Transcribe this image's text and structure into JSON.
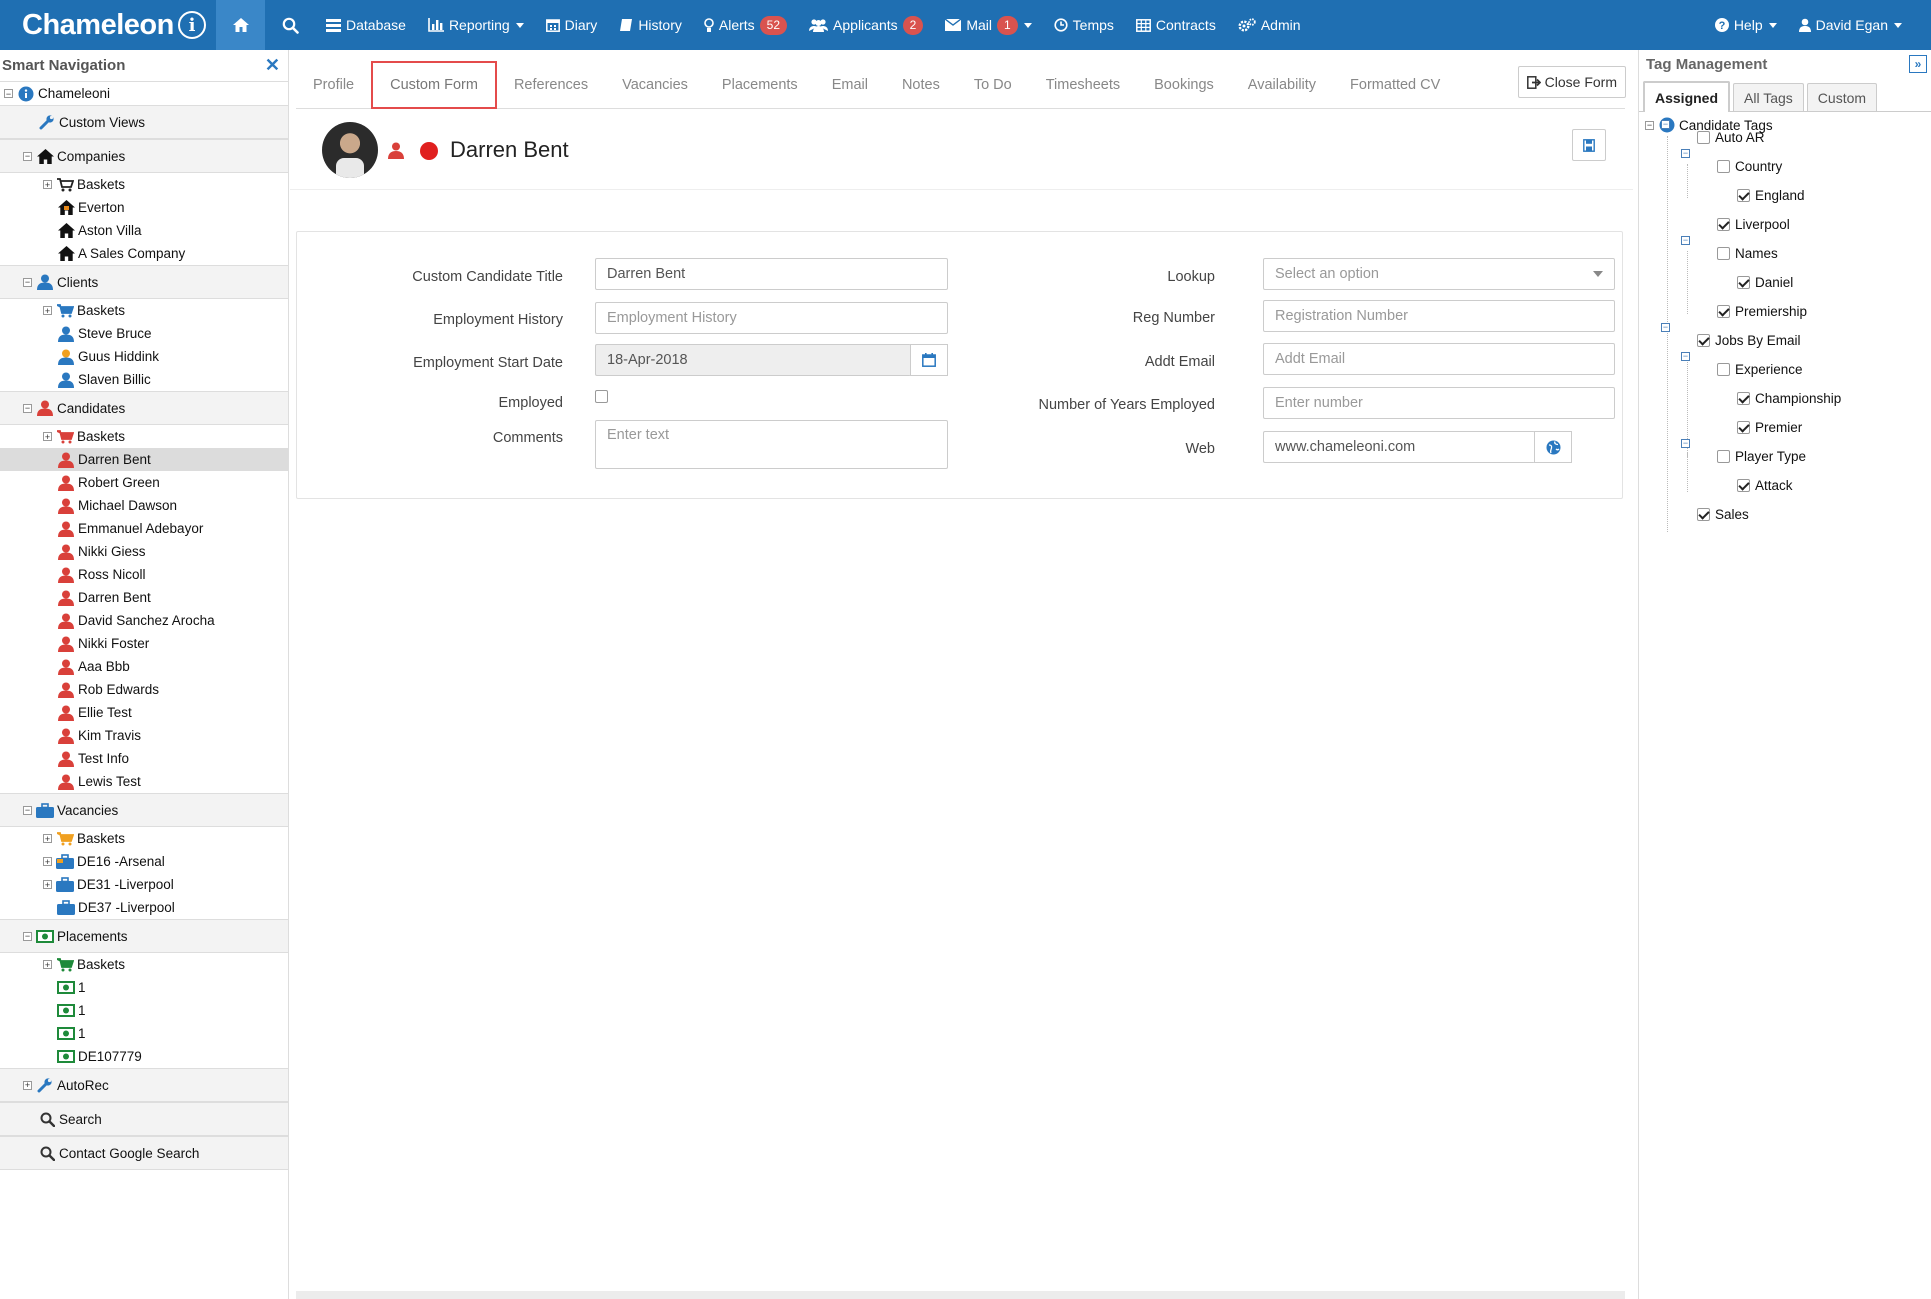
{
  "app": {
    "brand": "Chameleon",
    "brand_icon": "i"
  },
  "topnav": {
    "items": [
      {
        "label": "Database",
        "icon": "database-icon"
      },
      {
        "label": "Reporting",
        "icon": "bar-chart-icon",
        "dropdown": true
      },
      {
        "label": "Diary",
        "icon": "calendar-icon"
      },
      {
        "label": "History",
        "icon": "book-icon"
      },
      {
        "label": "Alerts",
        "icon": "bulb-icon",
        "badge": "52"
      },
      {
        "label": "Applicants",
        "icon": "users-icon",
        "badge": "2"
      },
      {
        "label": "Mail",
        "icon": "envelope-icon",
        "badge": "1",
        "dropdown": true
      },
      {
        "label": "Temps",
        "icon": "clock-icon"
      },
      {
        "label": "Contracts",
        "icon": "table-icon"
      },
      {
        "label": "Admin",
        "icon": "cogs-icon"
      }
    ],
    "help_label": "Help",
    "user_label": "David Egan"
  },
  "sidebar": {
    "title": "Smart Navigation",
    "root": "Chameleoni",
    "custom_views": "Custom Views",
    "companies": {
      "label": "Companies",
      "items": [
        "Baskets",
        "Everton",
        "Aston Villa",
        "A Sales Company"
      ]
    },
    "clients": {
      "label": "Clients",
      "items": [
        "Baskets",
        "Steve Bruce",
        "Guus Hiddink",
        "Slaven Billic"
      ]
    },
    "candidates": {
      "label": "Candidates",
      "items": [
        "Baskets",
        "Darren Bent",
        "Robert Green",
        "Michael Dawson",
        "Emmanuel Adebayor",
        "Nikki Giess",
        "Ross Nicoll",
        "Darren Bent",
        "David Sanchez Arocha",
        "Nikki Foster",
        "Aaa Bbb",
        "Rob Edwards",
        "Ellie Test",
        "Kim Travis",
        "Test Info",
        "Lewis Test"
      ],
      "selected_index": 1
    },
    "vacancies": {
      "label": "Vacancies",
      "items": [
        "Baskets",
        "DE16 -Arsenal",
        "DE31 -Liverpool",
        "DE37 -Liverpool"
      ]
    },
    "placements": {
      "label": "Placements",
      "items": [
        "Baskets",
        "1",
        "1",
        "1",
        "DE107779"
      ]
    },
    "autorec": "AutoRec",
    "search": "Search",
    "google_search": "Contact Google Search"
  },
  "tabs": [
    "Profile",
    "Custom Form",
    "References",
    "Vacancies",
    "Placements",
    "Email",
    "Notes",
    "To Do",
    "Timesheets",
    "Bookings",
    "Availability",
    "Formatted CV"
  ],
  "active_tab": "Custom Form",
  "close_form_label": "Close Form",
  "candidate": {
    "name": "Darren Bent",
    "status_color": "#e0201f"
  },
  "form": {
    "custom_title": {
      "label": "Custom Candidate Title",
      "value": "Darren Bent"
    },
    "employment_history": {
      "label": "Employment History",
      "placeholder": "Employment History"
    },
    "start_date": {
      "label": "Employment Start Date",
      "value": "18-Apr-2018"
    },
    "employed": {
      "label": "Employed",
      "checked": false
    },
    "comments": {
      "label": "Comments",
      "placeholder": "Enter text"
    },
    "lookup": {
      "label": "Lookup",
      "placeholder": "Select an option"
    },
    "reg_number": {
      "label": "Reg Number",
      "placeholder": "Registration Number"
    },
    "addt_email": {
      "label": "Addt Email",
      "placeholder": "Addt Email"
    },
    "years_employed": {
      "label": "Number of Years Employed",
      "placeholder": "Enter number"
    },
    "web": {
      "label": "Web",
      "value": "www.chameleoni.com"
    }
  },
  "tag_panel": {
    "title": "Tag Management",
    "tabs": [
      "Assigned",
      "All Tags",
      "Custom"
    ],
    "active_tab": "Assigned",
    "root": "Candidate Tags",
    "tags": [
      {
        "label": "Auto AR",
        "checked": false
      },
      {
        "label": "Country",
        "checked": false
      },
      {
        "label": "England",
        "checked": true
      },
      {
        "label": "Liverpool",
        "checked": true
      },
      {
        "label": "Names",
        "checked": false
      },
      {
        "label": "Daniel",
        "checked": true
      },
      {
        "label": "Premiership",
        "checked": true
      },
      {
        "label": "Jobs By Email",
        "checked": true
      },
      {
        "label": "Experience",
        "checked": false
      },
      {
        "label": "Championship",
        "checked": true
      },
      {
        "label": "Premier",
        "checked": true
      },
      {
        "label": "Player Type",
        "checked": false
      },
      {
        "label": "Attack",
        "checked": true
      },
      {
        "label": "Sales",
        "checked": true
      }
    ]
  },
  "colors": {
    "topbar": "#1f6fb2",
    "badge": "#d9534f",
    "active_tab_border": "#e44b4b",
    "candidate_icon": "#d9403a",
    "client_icon": "#2a78c0",
    "placement_icon": "#1e8a3a"
  }
}
